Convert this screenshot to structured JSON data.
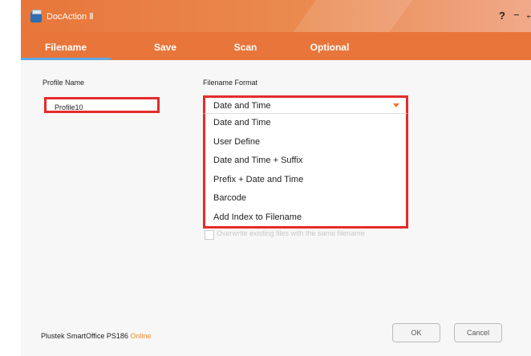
{
  "window": {
    "title": "DocAction Ⅱ",
    "help_label": "?",
    "minimize_label": "−",
    "back_label": "←"
  },
  "tabs": [
    {
      "label": "Filename",
      "active": true
    },
    {
      "label": "Save"
    },
    {
      "label": "Scan"
    },
    {
      "label": "Optional"
    }
  ],
  "form": {
    "profile_name_label": "Profile Name",
    "profile_name_value": "Profile10",
    "filename_format_label": "Filename Format",
    "filename_format_selected": "Date and Time",
    "filename_format_options": [
      "Date and Time",
      "User Define",
      "Date and Time + Suffix",
      "Prefix + Date and Time",
      "Barcode",
      "Add Index to Filename"
    ],
    "overwrite_label": "Overwrite existing files with the same filename"
  },
  "footer": {
    "device_name": "Plustek SmartOffice PS186",
    "device_status": "Online",
    "ok_label": "OK",
    "cancel_label": "Cancel"
  },
  "colors": {
    "accent": "#e8763a",
    "highlight_border": "#e52b2b",
    "tab_underline": "#5fa8e0",
    "status_online": "#f08a2a"
  }
}
